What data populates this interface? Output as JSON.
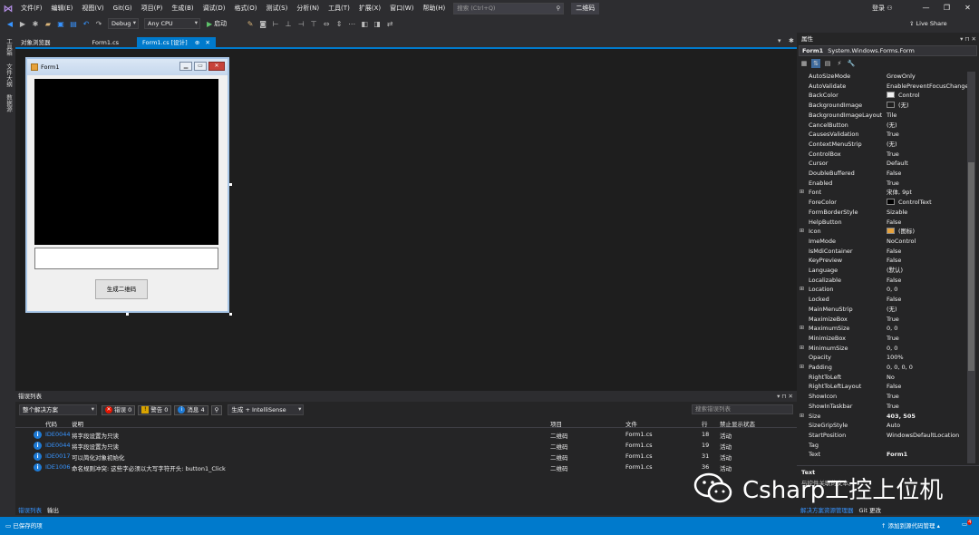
{
  "menu": {
    "items": [
      "文件(F)",
      "编辑(E)",
      "视图(V)",
      "Git(G)",
      "项目(P)",
      "生成(B)",
      "调试(D)",
      "格式(O)",
      "测试(S)",
      "分析(N)",
      "工具(T)",
      "扩展(X)",
      "窗口(W)",
      "帮助(H)"
    ],
    "search_placeholder": "搜索 (Ctrl+Q)",
    "solution_name": "二维码",
    "login": "登录",
    "window_controls": [
      "—",
      "❐",
      "✕"
    ]
  },
  "toolbar": {
    "config": "Debug",
    "platform": "Any CPU",
    "start_label": "启动",
    "live_share": "Live Share"
  },
  "left_rail": [
    "工具箱",
    "文件大纲",
    "数据源"
  ],
  "doc_tabs": [
    {
      "label": "对象浏览器",
      "active": false
    },
    {
      "label": "Form1.cs",
      "active": false
    },
    {
      "label": "Form1.cs [设计]",
      "active": true,
      "pin": "⊕",
      "close": "✕"
    }
  ],
  "designer": {
    "form_title": "Form1",
    "form_controls": [
      "▁",
      "▭",
      "✕"
    ],
    "button_label": "生成二维码"
  },
  "error_list": {
    "title": "错误列表",
    "header_icons": "▾ ⊓ ✕",
    "scope": "整个解决方案",
    "errors_chip": {
      "icon": "✕",
      "label": "错误 0"
    },
    "warnings_chip": {
      "icon": "!",
      "label": "警告 0"
    },
    "messages_chip": {
      "icon": "i",
      "label": "消息 4"
    },
    "filter_icon": "⚲",
    "build_filter": "生成 + IntelliSense",
    "search_placeholder": "搜索错误列表",
    "columns": {
      "code": "代码",
      "desc": "说明",
      "project": "项目",
      "file": "文件",
      "line": "行",
      "suppress": "禁止显示状态"
    },
    "rows": [
      {
        "code": "IDE0044",
        "desc": "将字段设置为只读",
        "project": "二维码",
        "file": "Form1.cs",
        "line": "18",
        "state": "活动"
      },
      {
        "code": "IDE0044",
        "desc": "将字段设置为只读",
        "project": "二维码",
        "file": "Form1.cs",
        "line": "19",
        "state": "活动"
      },
      {
        "code": "IDE0017",
        "desc": "可以简化对象初始化",
        "project": "二维码",
        "file": "Form1.cs",
        "line": "31",
        "state": "活动"
      },
      {
        "code": "IDE1006",
        "desc": "命名规则冲突: 这些字必须以大写字符开头: button1_Click",
        "project": "二维码",
        "file": "Form1.cs",
        "line": "36",
        "state": "活动"
      }
    ],
    "bottom_tabs": [
      "错误列表",
      "输出"
    ]
  },
  "properties": {
    "title": "属性",
    "title_icons": "▾ ⊓ ✕",
    "object_name": "Form1",
    "object_type": "System.Windows.Forms.Form",
    "toolbar_icons": [
      "▦",
      "⇅",
      "▤",
      "⚡",
      "🔧"
    ],
    "rows": [
      {
        "name": "AutoSizeMode",
        "value": "GrowOnly"
      },
      {
        "name": "AutoValidate",
        "value": "EnablePreventFocusChange"
      },
      {
        "name": "BackColor",
        "value": "Control",
        "swatch": "#f0f0f0"
      },
      {
        "name": "BackgroundImage",
        "value": "(无)",
        "swatch": "#1e1e1e"
      },
      {
        "name": "BackgroundImageLayout",
        "value": "Tile"
      },
      {
        "name": "CancelButton",
        "value": "(无)"
      },
      {
        "name": "CausesValidation",
        "value": "True"
      },
      {
        "name": "ContextMenuStrip",
        "value": "(无)"
      },
      {
        "name": "ControlBox",
        "value": "True"
      },
      {
        "name": "Cursor",
        "value": "Default"
      },
      {
        "name": "DoubleBuffered",
        "value": "False"
      },
      {
        "name": "Enabled",
        "value": "True"
      },
      {
        "name": "Font",
        "value": "宋体, 9pt",
        "exp": "⊞"
      },
      {
        "name": "ForeColor",
        "value": "ControlText",
        "swatch": "#000000"
      },
      {
        "name": "FormBorderStyle",
        "value": "Sizable"
      },
      {
        "name": "HelpButton",
        "value": "False"
      },
      {
        "name": "Icon",
        "value": "(图标)",
        "exp": "⊞",
        "swatch": "#e6a23c"
      },
      {
        "name": "ImeMode",
        "value": "NoControl"
      },
      {
        "name": "IsMdiContainer",
        "value": "False"
      },
      {
        "name": "KeyPreview",
        "value": "False"
      },
      {
        "name": "Language",
        "value": "(默认)"
      },
      {
        "name": "Localizable",
        "value": "False"
      },
      {
        "name": "Location",
        "value": "0, 0",
        "exp": "⊞"
      },
      {
        "name": "Locked",
        "value": "False"
      },
      {
        "name": "MainMenuStrip",
        "value": "(无)"
      },
      {
        "name": "MaximizeBox",
        "value": "True"
      },
      {
        "name": "MaximumSize",
        "value": "0, 0",
        "exp": "⊞"
      },
      {
        "name": "MinimizeBox",
        "value": "True"
      },
      {
        "name": "MinimumSize",
        "value": "0, 0",
        "exp": "⊞"
      },
      {
        "name": "Opacity",
        "value": "100%"
      },
      {
        "name": "Padding",
        "value": "0, 0, 0, 0",
        "exp": "⊞"
      },
      {
        "name": "RightToLeft",
        "value": "No"
      },
      {
        "name": "RightToLeftLayout",
        "value": "False"
      },
      {
        "name": "ShowIcon",
        "value": "True"
      },
      {
        "name": "ShowInTaskbar",
        "value": "True"
      },
      {
        "name": "Size",
        "value": "403, 505",
        "exp": "⊞",
        "bold": true
      },
      {
        "name": "SizeGripStyle",
        "value": "Auto"
      },
      {
        "name": "StartPosition",
        "value": "WindowsDefaultLocation"
      },
      {
        "name": "Tag",
        "value": ""
      },
      {
        "name": "Text",
        "value": "Form1",
        "bold": true
      }
    ],
    "desc_title": "Text",
    "desc_text": "与控件关联的文本。",
    "bottom_tabs": [
      "解决方案资源管理器",
      "Git 更改"
    ]
  },
  "status": {
    "left": "已保存的项",
    "right": "↑ 添加到源代码管理 ▴",
    "notify_count": "4"
  },
  "watermark": {
    "text": "Csharp工控上位机"
  }
}
